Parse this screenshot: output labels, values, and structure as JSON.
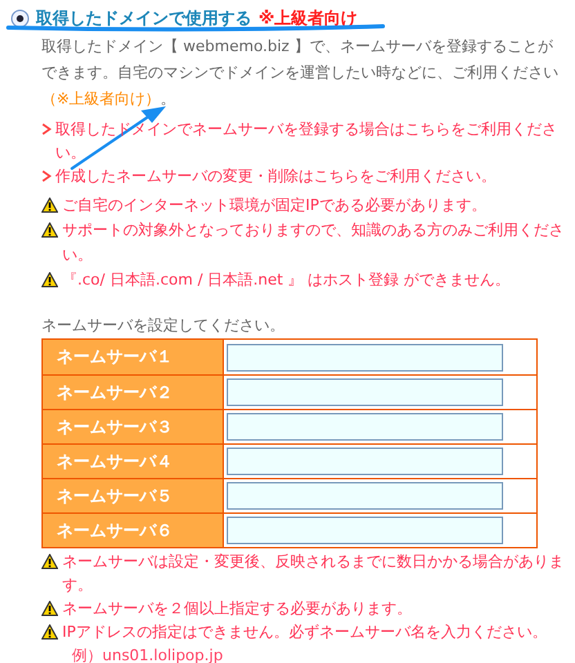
{
  "option": {
    "label": "取得したドメインで使用する",
    "note": "※上級者向け",
    "selected": true
  },
  "description": {
    "text": "取得したドメイン【 webmemo.biz 】で、ネームサーバを登録することができます。自宅のマシンでドメインを運営したい時などに、ご利用ください",
    "note": "（※上級者向け）",
    "end": "。"
  },
  "links": [
    "取得したドメインでネームサーバを登録する場合はこちらをご利用ください。",
    "作成したネームサーバの変更・削除はこちらをご利用ください。"
  ],
  "warnings": [
    "ご自宅のインターネット環境が固定IPである必要があります。",
    "サポートの対象外となっておりますので、知識のある方のみご利用ください。",
    "『.co/ 日本語.com / 日本語.net 』 はホスト登録 ができません。"
  ],
  "prompt": "ネームサーバを設定してください。",
  "nameservers": [
    {
      "label": "ネームサーバ１"
    },
    {
      "label": "ネームサーバ２"
    },
    {
      "label": "ネームサーバ３"
    },
    {
      "label": "ネームサーバ４"
    },
    {
      "label": "ネームサーバ５"
    },
    {
      "label": "ネームサーバ６"
    }
  ],
  "notes": [
    {
      "text": "ネームサーバは設定・変更後、反映されるまでに数日かかる場合があります。"
    },
    {
      "text": "ネームサーバを２個以上指定する必要があります。"
    },
    {
      "text": "IPアドレスの指定はできません。必ずネームサーバ名を入力ください。",
      "example": "例）uns01.lolipop.jp"
    }
  ]
}
